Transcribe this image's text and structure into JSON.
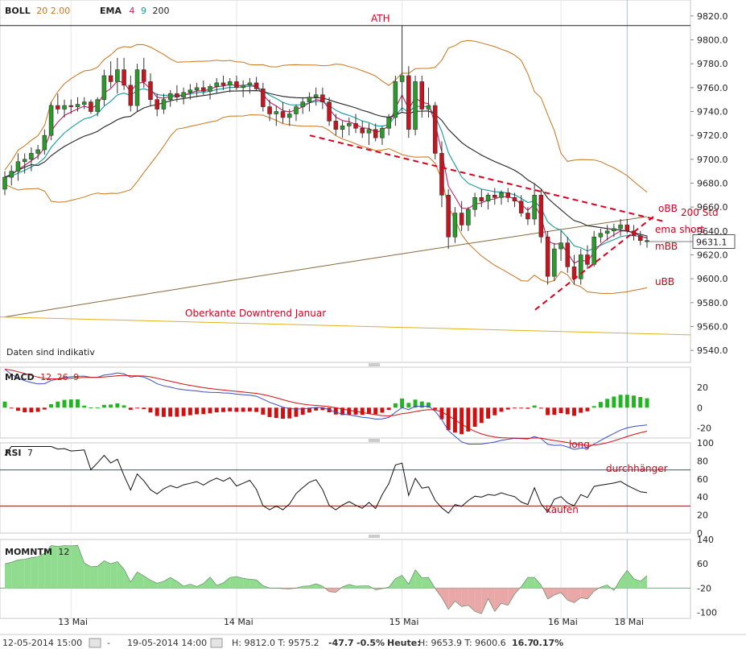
{
  "chart_data": [
    {
      "type": "candlestick",
      "indicators": [
        {
          "name": "BOLL",
          "params": "20 2.00",
          "color": "#c8741a"
        },
        {
          "name": "EMA",
          "params": [
            "4",
            "9",
            "200"
          ],
          "colors": [
            "#c02060",
            "#149aa0",
            "#222222"
          ]
        }
      ],
      "ylim": [
        9530,
        9830
      ],
      "yticks": [
        "9820.0",
        "9800.0",
        "9780.0",
        "9760.0",
        "9740.0",
        "9720.0",
        "9700.0",
        "9680.0",
        "9660.0",
        "9640.0",
        "9620.0",
        "9600.0",
        "9580.0",
        "9560.0",
        "9540.0"
      ],
      "ytick_values": [
        9820,
        9800,
        9780,
        9760,
        9740,
        9720,
        9700,
        9680,
        9660,
        9640,
        9620,
        9600,
        9580,
        9560,
        9540
      ],
      "last_price_label": "9631.1",
      "last_price": 9631.1,
      "ath_level": 9812,
      "note": "Daten sind indikativ",
      "x_labels": [
        "13 Mai",
        "14 Mai",
        "15 Mai",
        "16 Mai",
        "18 Mai"
      ],
      "candles": [
        [
          9675,
          9690,
          9670,
          9685
        ],
        [
          9685,
          9695,
          9678,
          9690
        ],
        [
          9690,
          9705,
          9682,
          9698
        ],
        [
          9698,
          9705,
          9688,
          9700
        ],
        [
          9700,
          9710,
          9690,
          9705
        ],
        [
          9705,
          9712,
          9700,
          9708
        ],
        [
          9708,
          9725,
          9704,
          9720
        ],
        [
          9720,
          9748,
          9716,
          9745
        ],
        [
          9745,
          9755,
          9738,
          9742
        ],
        [
          9742,
          9750,
          9735,
          9745
        ],
        [
          9745,
          9750,
          9738,
          9744
        ],
        [
          9744,
          9752,
          9740,
          9746
        ],
        [
          9746,
          9752,
          9742,
          9748
        ],
        [
          9748,
          9750,
          9738,
          9740
        ],
        [
          9740,
          9752,
          9736,
          9750
        ],
        [
          9750,
          9775,
          9745,
          9770
        ],
        [
          9770,
          9782,
          9760,
          9765
        ],
        [
          9765,
          9785,
          9755,
          9775
        ],
        [
          9775,
          9785,
          9758,
          9762
        ],
        [
          9762,
          9770,
          9740,
          9745
        ],
        [
          9745,
          9780,
          9740,
          9775
        ],
        [
          9775,
          9785,
          9760,
          9765
        ],
        [
          9765,
          9772,
          9745,
          9750
        ],
        [
          9750,
          9755,
          9736,
          9742
        ],
        [
          9742,
          9755,
          9738,
          9750
        ],
        [
          9750,
          9758,
          9744,
          9755
        ],
        [
          9755,
          9762,
          9748,
          9752
        ],
        [
          9752,
          9760,
          9746,
          9756
        ],
        [
          9756,
          9763,
          9750,
          9758
        ],
        [
          9758,
          9764,
          9752,
          9760
        ],
        [
          9760,
          9766,
          9754,
          9757
        ],
        [
          9757,
          9763,
          9750,
          9761
        ],
        [
          9761,
          9768,
          9755,
          9764
        ],
        [
          9764,
          9770,
          9758,
          9762
        ],
        [
          9762,
          9768,
          9756,
          9765
        ],
        [
          9765,
          9770,
          9758,
          9760
        ],
        [
          9760,
          9766,
          9752,
          9762
        ],
        [
          9762,
          9768,
          9755,
          9764
        ],
        [
          9764,
          9769,
          9757,
          9759
        ],
        [
          9759,
          9764,
          9740,
          9744
        ],
        [
          9744,
          9750,
          9732,
          9738
        ],
        [
          9738,
          9745,
          9728,
          9740
        ],
        [
          9740,
          9748,
          9730,
          9735
        ],
        [
          9735,
          9742,
          9728,
          9738
        ],
        [
          9738,
          9746,
          9732,
          9744
        ],
        [
          9744,
          9752,
          9738,
          9748
        ],
        [
          9748,
          9756,
          9740,
          9752
        ],
        [
          9752,
          9760,
          9745,
          9754
        ],
        [
          9754,
          9760,
          9742,
          9748
        ],
        [
          9748,
          9752,
          9728,
          9732
        ],
        [
          9732,
          9738,
          9720,
          9725
        ],
        [
          9725,
          9732,
          9718,
          9728
        ],
        [
          9728,
          9735,
          9720,
          9730
        ],
        [
          9730,
          9738,
          9722,
          9726
        ],
        [
          9726,
          9732,
          9718,
          9722
        ],
        [
          9722,
          9730,
          9712,
          9725
        ],
        [
          9725,
          9730,
          9715,
          9718
        ],
        [
          9718,
          9728,
          9712,
          9726
        ],
        [
          9726,
          9738,
          9720,
          9735
        ],
        [
          9735,
          9770,
          9728,
          9765
        ],
        [
          9765,
          9812,
          9740,
          9770
        ],
        [
          9770,
          9778,
          9718,
          9725
        ],
        [
          9725,
          9770,
          9720,
          9765
        ],
        [
          9765,
          9770,
          9735,
          9742
        ],
        [
          9742,
          9760,
          9735,
          9745
        ],
        [
          9745,
          9748,
          9700,
          9705
        ],
        [
          9705,
          9715,
          9660,
          9670
        ],
        [
          9670,
          9675,
          9625,
          9635
        ],
        [
          9635,
          9660,
          9630,
          9655
        ],
        [
          9655,
          9665,
          9640,
          9645
        ],
        [
          9645,
          9660,
          9640,
          9658
        ],
        [
          9658,
          9672,
          9652,
          9668
        ],
        [
          9668,
          9675,
          9660,
          9665
        ],
        [
          9665,
          9672,
          9658,
          9670
        ],
        [
          9670,
          9676,
          9662,
          9668
        ],
        [
          9668,
          9674,
          9662,
          9672
        ],
        [
          9672,
          9676,
          9664,
          9668
        ],
        [
          9668,
          9672,
          9660,
          9665
        ],
        [
          9665,
          9670,
          9652,
          9655
        ],
        [
          9655,
          9660,
          9645,
          9650
        ],
        [
          9650,
          9680,
          9645,
          9670
        ],
        [
          9670,
          9675,
          9630,
          9635
        ],
        [
          9635,
          9640,
          9595,
          9602
        ],
        [
          9602,
          9630,
          9598,
          9625
        ],
        [
          9625,
          9640,
          9615,
          9630
        ],
        [
          9630,
          9635,
          9605,
          9610
        ],
        [
          9610,
          9620,
          9595,
          9600
        ],
        [
          9600,
          9625,
          9595,
          9620
        ],
        [
          9620,
          9628,
          9608,
          9612
        ],
        [
          9612,
          9640,
          9610,
          9635
        ],
        [
          9635,
          9642,
          9630,
          9638
        ],
        [
          9638,
          9645,
          9632,
          9640
        ],
        [
          9640,
          9646,
          9635,
          9642
        ],
        [
          9642,
          9650,
          9636,
          9645
        ],
        [
          9645,
          9650,
          9638,
          9640
        ],
        [
          9640,
          9645,
          9632,
          9636
        ],
        [
          9636,
          9640,
          9628,
          9632
        ],
        [
          9632,
          9636,
          9626,
          9631
        ]
      ],
      "annotations": [
        {
          "text": "ATH"
        },
        {
          "text": "Oberkante Downtrend Januar"
        },
        {
          "text": "oBB"
        },
        {
          "text": "200 Std"
        },
        {
          "text": "ema short"
        },
        {
          "text": "mBB"
        },
        {
          "text": "uBB"
        }
      ]
    },
    {
      "type": "bar+line",
      "name": "MACD",
      "params": [
        "12",
        "26",
        "9"
      ],
      "ylim": [
        -30,
        40
      ],
      "yticks": [
        "20",
        "0",
        "-20"
      ],
      "ytick_values": [
        20,
        0,
        -20
      ],
      "annotations": [
        {
          "text": "long"
        }
      ]
    },
    {
      "type": "line",
      "name": "RSI",
      "params": "7",
      "ylim": [
        0,
        100
      ],
      "yticks": [
        "100",
        "80",
        "60",
        "40",
        "20",
        "0"
      ],
      "ytick_values": [
        100,
        80,
        60,
        40,
        20,
        0
      ],
      "levels": [
        70,
        30
      ],
      "annotations": [
        {
          "text": "durchhänger"
        },
        {
          "text": "kaufen"
        }
      ]
    },
    {
      "type": "area",
      "name": "MOMNTM",
      "params": "12",
      "ylim": [
        -120,
        140
      ],
      "yticks": [
        "140",
        "60",
        "-20",
        "-100"
      ],
      "ytick_values": [
        140,
        60,
        -20,
        -100
      ]
    }
  ],
  "footer": {
    "from": "12-05-2014 15:00",
    "to": "19-05-2014 14:00",
    "hl_label": "H: 9812.0 T: 9575.2",
    "chg": "-47.7",
    "chg_pct": "-0.5%",
    "heute_label": "Heute:",
    "heute_vals": "H: 9653.9 T: 9600.6",
    "heute_chg": "16.7",
    "heute_pct": "0.17%"
  },
  "colors": {
    "up": "#2a9a2a",
    "down": "#c8141e",
    "annotation": "#d6001c",
    "boll": "#c8741a",
    "ema200": "#8b6a3e"
  }
}
